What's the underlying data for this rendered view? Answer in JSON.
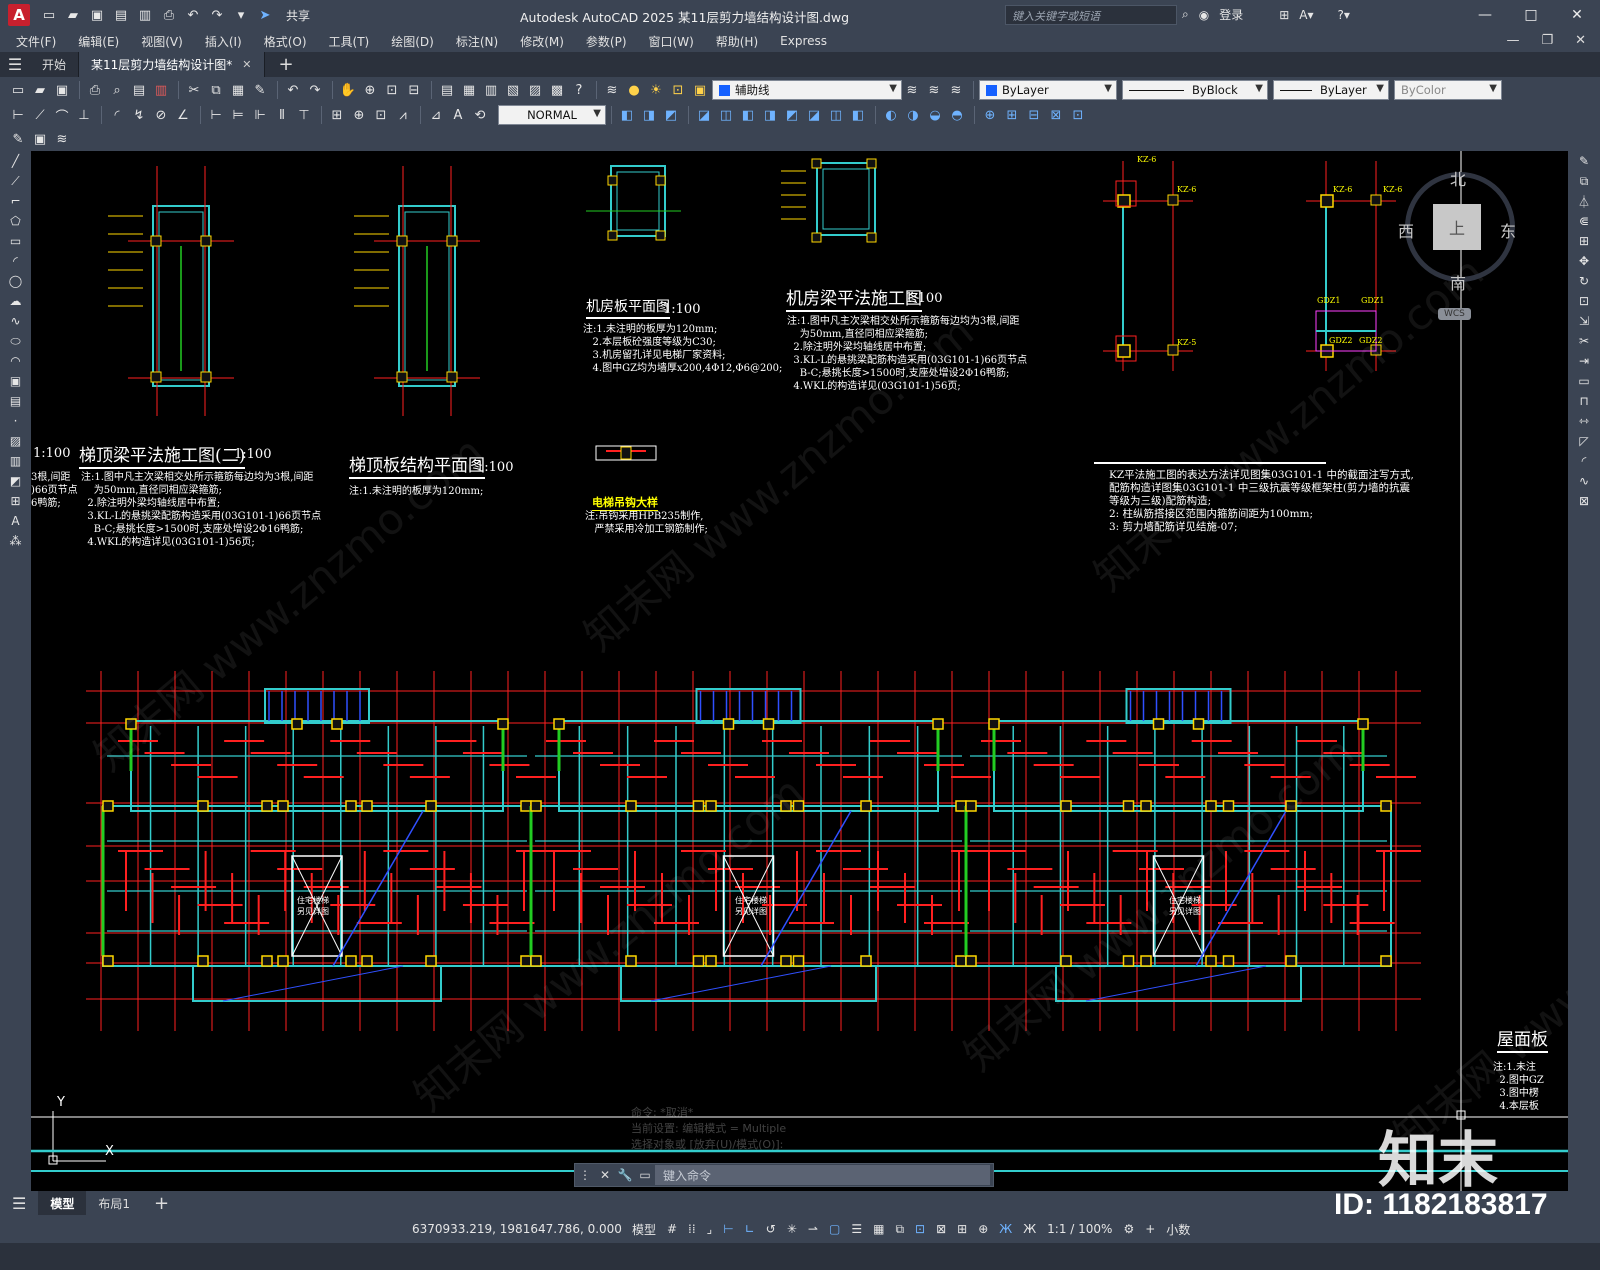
{
  "titlebar": {
    "app_logo": "A",
    "share_label": "共享",
    "title": "Autodesk AutoCAD 2025    某11层剪力墙结构设计图.dwg",
    "search_placeholder": "键入关键字或短语",
    "signin": "登录"
  },
  "menu": [
    "文件(F)",
    "编辑(E)",
    "视图(V)",
    "插入(I)",
    "格式(O)",
    "工具(T)",
    "绘图(D)",
    "标注(N)",
    "修改(M)",
    "参数(P)",
    "窗口(W)",
    "帮助(H)",
    "Express"
  ],
  "tabs": {
    "start": "开始",
    "document": "某11层剪力墙结构设计图*"
  },
  "toolbar": {
    "layer_value": "辅助线",
    "color_value": "ByLayer",
    "linetype_value": "ByBlock",
    "lineweight_value": "ByLayer",
    "plotstyle_value": "ByColor",
    "dimstyle_value": "NORMAL"
  },
  "drawing": {
    "titles": {
      "t1": "梯顶梁平法施工图(二)",
      "t2": "梯顶板结构平面图",
      "t3": "机房板平面图",
      "t4": "机房梁平法施工图",
      "t5": "电梯吊钩大样",
      "t6": "屋面板"
    },
    "scales": {
      "s0": "1:100",
      "s1": "1:100",
      "s2": "1:100",
      "s3": "1:100",
      "s4": "1:100"
    },
    "notes": {
      "n1": "注:1.图中凡主次梁相交处所示箍筋每边均为3根,间距\n    为50mm,直径同相应梁箍筋;\n  2.除注明外梁均轴线居中布置;\n  3.KL-L的悬挑梁配筋构造采用(03G101-1)66页节点\n    B-C;悬挑长度>1500时,支座处增设2Φ16鸭筋;\n  4.WKL的构造详见(03G101-1)56页;",
      "n2": "注:1.未注明的板厚为120mm;",
      "n3": "注:1.未注明的板厚为120mm;\n   2.本层板砼强度等级为C30;\n   3.机房留孔详见电梯厂家资料;\n   4.图中GZ均为墙厚x200,4Φ12,Φ6@200;",
      "n4": "注:1.图中凡主次梁相交处所示箍筋每边均为3根,间距\n    为50mm,直径同相应梁箍筋;\n  2.除注明外梁均轴线居中布置;\n  3.KL-L的悬挑梁配筋构造采用(03G101-1)66页节点\n    B-C;悬挑长度>1500时,支座处增设2Φ16鸭筋;\n  4.WKL的构造详见(03G101-1)56页;",
      "n5": "注:吊钩采用HPB235制作,\n   严禁采用冷加工钢筋制作;",
      "n6": "KZ平法施工图的表达方法详见图集03G101-1 中的截面注写方式,\n配筋构造详图集03G101-1 中三级抗震等级框架柱(剪力墙的抗震\n等级为三级)配筋构造;\n2: 柱纵筋搭接区范围内箍筋间距为100mm;\n3: 剪力墙配筋详见结施-07;",
      "n0": "3根,间距\n)66页节点\n6鸭筋;",
      "n7": "注:1.未注\n  2.图中GZ\n  3.图中楞\n  4.本层板"
    },
    "stair_labels": [
      "住宅楼梯\n另见详图",
      "住宅楼梯\n另见详图",
      "住宅楼梯\n另见详图"
    ],
    "kz_labels": [
      "KZ-6",
      "KZ-6",
      "KZ-6",
      "KZ-6",
      "KZ-5",
      "GDZ1",
      "GDZ1",
      "GDZ2",
      "GDZ2"
    ],
    "watermark": "知末网 www.znzmo.com"
  },
  "viewcube": {
    "north": "北",
    "south": "南",
    "east": "东",
    "west": "西",
    "face": "上",
    "wcs": "WCS"
  },
  "ucs": {
    "x": "X",
    "y": "Y"
  },
  "command": {
    "history": [
      "命令: *取消*",
      "当前设置: 编辑模式 = Multiple",
      "选择对象或 [放弃(U)/模式(O)]:"
    ],
    "placeholder": "键入命令"
  },
  "layout_tabs": [
    "模型",
    "布局1"
  ],
  "status": {
    "coords": "6370933.219, 1981647.786, 0.000",
    "space": "模型",
    "scale": "1:1 / 100%",
    "units": "小数"
  },
  "brand": {
    "logo_text": "知末",
    "id_text": "ID: 1182183817"
  }
}
